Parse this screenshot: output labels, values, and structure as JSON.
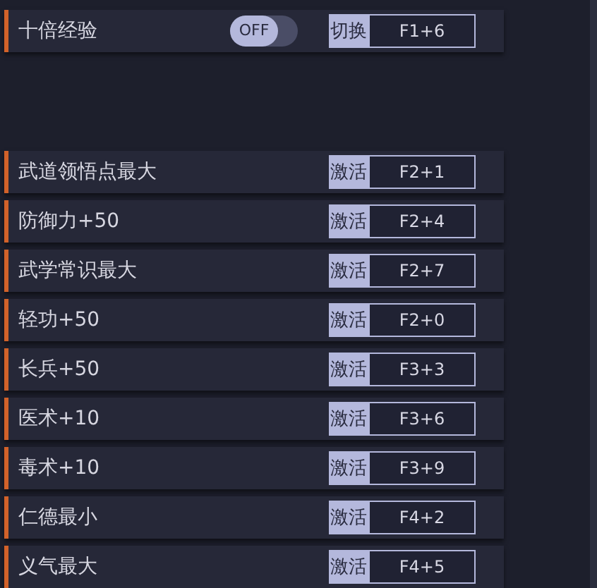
{
  "toggle_row": {
    "label": "十倍经验",
    "switch": {
      "text": "OFF",
      "on": false
    },
    "action": "切换",
    "hotkey": "F1+6"
  },
  "cheats": [
    {
      "label": "武道领悟点最大",
      "action": "激活",
      "hotkey": "F2+1"
    },
    {
      "label": "防御力+50",
      "action": "激活",
      "hotkey": "F2+4"
    },
    {
      "label": "武学常识最大",
      "action": "激活",
      "hotkey": "F2+7"
    },
    {
      "label": "轻功+50",
      "action": "激活",
      "hotkey": "F2+0"
    },
    {
      "label": "长兵+50",
      "action": "激活",
      "hotkey": "F3+3"
    },
    {
      "label": "医术+10",
      "action": "激活",
      "hotkey": "F3+6"
    },
    {
      "label": "毒术+10",
      "action": "激活",
      "hotkey": "F3+9"
    },
    {
      "label": "仁德最小",
      "action": "激活",
      "hotkey": "F4+2"
    },
    {
      "label": "义气最大",
      "action": "激活",
      "hotkey": "F4+5"
    }
  ]
}
